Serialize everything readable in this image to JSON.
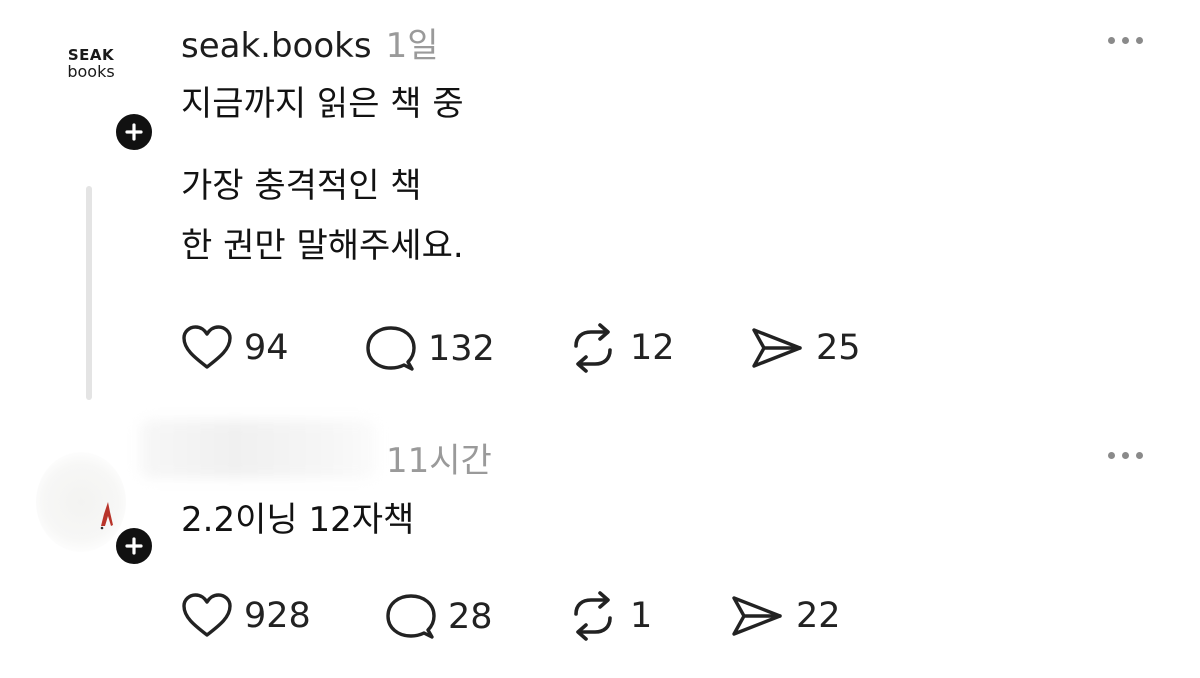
{
  "posts": [
    {
      "avatar": {
        "line1": "SEAK",
        "line2": "books"
      },
      "username": "seak.books",
      "time": "1일",
      "lines": [
        "지금까지 읽은 책 중",
        "가장 충격적인 책",
        "한 권만 말해주세요."
      ],
      "actions": {
        "likes": "94",
        "comments": "132",
        "reposts": "12",
        "shares": "25"
      }
    },
    {
      "username": "",
      "time": "11시간",
      "lines": [
        "2.2이닝 12자책"
      ],
      "actions": {
        "likes": "928",
        "comments": "28",
        "reposts": "1",
        "shares": "22"
      }
    }
  ],
  "icons": {
    "like": "heart-icon",
    "comment": "comment-icon",
    "repost": "repost-icon",
    "share": "share-icon",
    "more": "more-icon",
    "follow": "plus-icon"
  }
}
